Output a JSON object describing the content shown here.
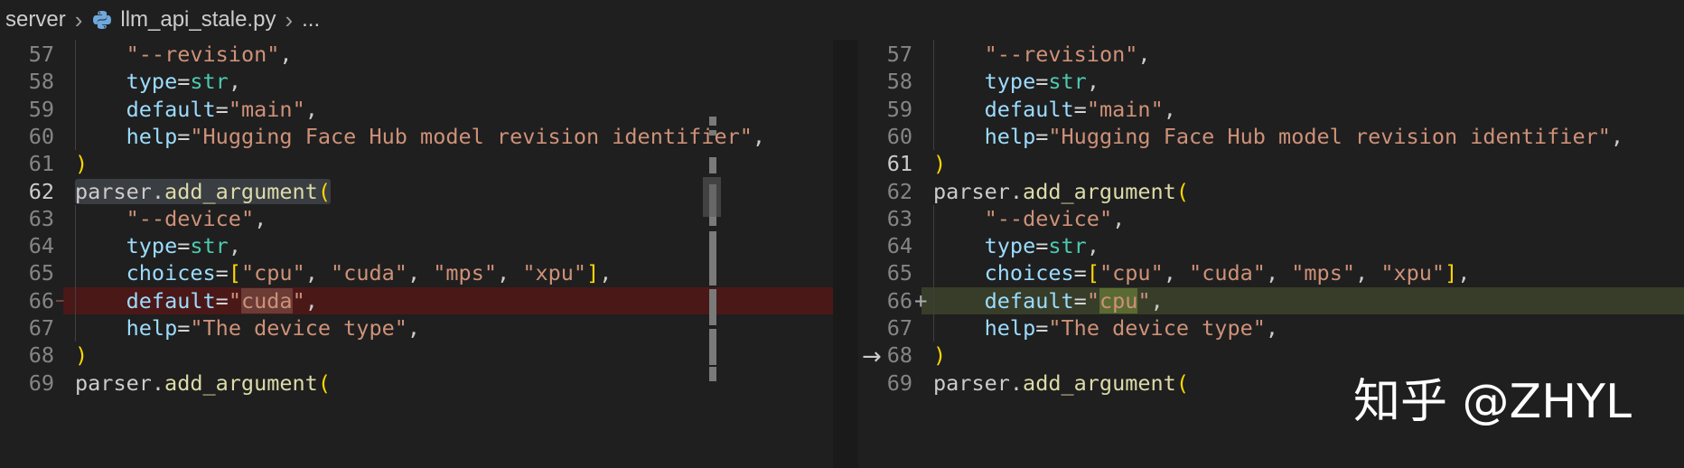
{
  "breadcrumb": {
    "folder": "server",
    "file": "llm_api_stale.py",
    "more": "..."
  },
  "watermark": "知乎 @ZHYL",
  "left_pane": {
    "lines": [
      {
        "num": "57",
        "code": "    \"--revision\","
      },
      {
        "num": "58",
        "code": "    type=str,"
      },
      {
        "num": "59",
        "code": "    default=\"main\","
      },
      {
        "num": "60",
        "code": "    help=\"Hugging Face Hub model revision identifier\","
      },
      {
        "num": "61",
        "code": ")"
      },
      {
        "num": "62",
        "code": "parser.add_argument("
      },
      {
        "num": "63",
        "code": "    \"--device\","
      },
      {
        "num": "64",
        "code": "    type=str,"
      },
      {
        "num": "65",
        "code": "    choices=[\"cpu\", \"cuda\", \"mps\", \"xpu\"],"
      },
      {
        "num": "66",
        "code": "    default=\"cuda\","
      },
      {
        "num": "67",
        "code": "    help=\"The device type\","
      },
      {
        "num": "68",
        "code": ")"
      },
      {
        "num": "69",
        "code": "parser.add_argument("
      }
    ]
  },
  "right_pane": {
    "lines": [
      {
        "num": "57",
        "code": "    \"--revision\","
      },
      {
        "num": "58",
        "code": "    type=str,"
      },
      {
        "num": "59",
        "code": "    default=\"main\","
      },
      {
        "num": "60",
        "code": "    help=\"Hugging Face Hub model revision identifier\","
      },
      {
        "num": "61",
        "code": ")"
      },
      {
        "num": "62",
        "code": "parser.add_argument("
      },
      {
        "num": "63",
        "code": "    \"--device\","
      },
      {
        "num": "64",
        "code": "    type=str,"
      },
      {
        "num": "65",
        "code": "    choices=[\"cpu\", \"cuda\", \"mps\", \"xpu\"],"
      },
      {
        "num": "66",
        "code": "    default=\"cpu\","
      },
      {
        "num": "67",
        "code": "    help=\"The device type\","
      },
      {
        "num": "68",
        "code": ")"
      },
      {
        "num": "69",
        "code": "parser.add_argument("
      }
    ]
  },
  "icons": {
    "python_file": "python-icon",
    "diff_arrow": "arrow-right-icon"
  },
  "colors": {
    "background": "#1f1f1f",
    "removed_line": "#4b1818",
    "added_line": "#373d29",
    "string": "#ce9178",
    "property": "#9cdcfe",
    "builtin_type": "#4ec9b0",
    "function": "#dcdcaa",
    "bracket_gold": "#ffd700",
    "bracket_purple": "#da70d6"
  }
}
